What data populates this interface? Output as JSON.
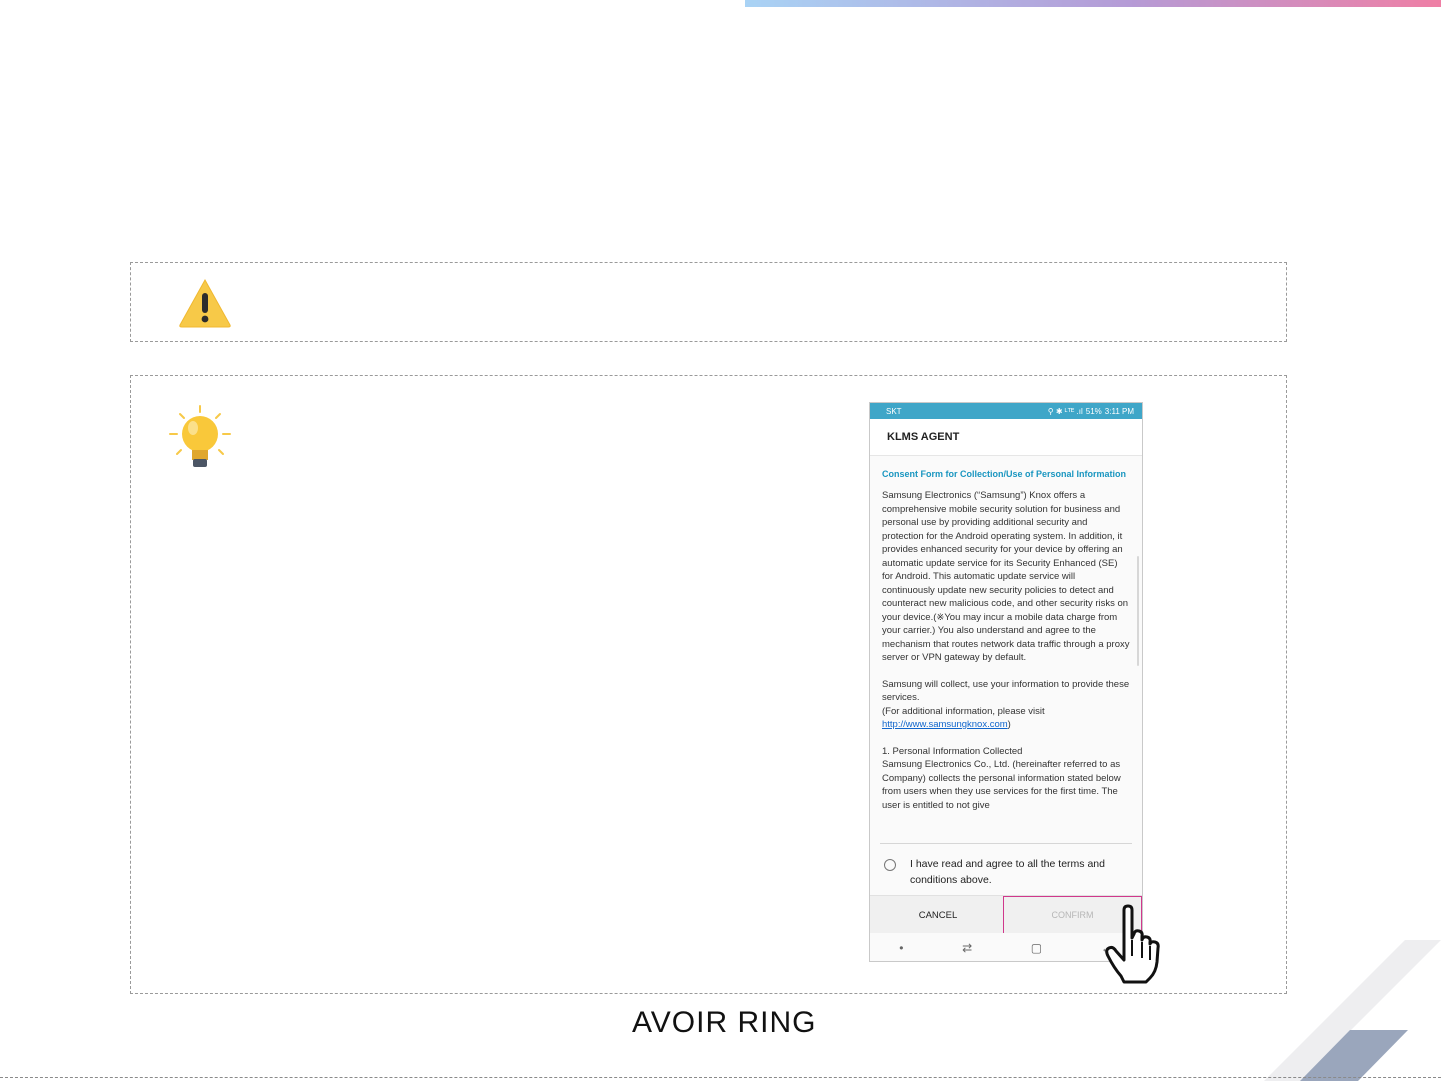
{
  "phone": {
    "status": {
      "carrier": "SKT",
      "icons": "⚲ ✱ ᴸᵀᴱ .ıl",
      "battery": "51%",
      "time": "3:11 PM"
    },
    "app_title": "KLMS AGENT",
    "consent_title": "Consent Form for Collection/Use of Personal Information",
    "paragraph_1": " Samsung Electronics (“Samsung”) Knox offers a comprehensive mobile security solution for business and personal use by providing additional security and protection for the Android operating system. In addition, it provides enhanced security for your device by offering an automatic update service for its Security Enhanced (SE) for Android. This automatic update service will continuously update new security policies to detect and counteract new malicious code, and other security risks on your device.(※You may incur a mobile data charge from your carrier.) You also understand and agree to the mechanism that routes network data traffic through a proxy server or VPN gateway by default.",
    "paragraph_2": " Samsung will collect, use your information to provide these services.\n(For additional information, please visit",
    "link": "http://www.samsungknox.com",
    "link_suffix": ")",
    "paragraph_3": " 1. Personal Information Collected\nSamsung Electronics Co., Ltd. (hereinafter referred to as Company) collects the personal information stated below from users when they use services for the first time. The user is entitled to not give",
    "agree_text": "I have read and agree to all the terms and conditions above.",
    "cancel_label": "CANCEL",
    "confirm_label": "CONFIRM"
  },
  "footer": {
    "brand_text": "AVOIR RING"
  },
  "colors": {
    "statusbar": "#3fa6c8",
    "consent_title": "#1a96c0",
    "confirm_highlight": "#d0388c",
    "warning": "#f7c948",
    "bulb": "#f9c83a"
  },
  "icons": [
    "warning-icon",
    "lightbulb-icon",
    "pointing-hand-icon"
  ]
}
